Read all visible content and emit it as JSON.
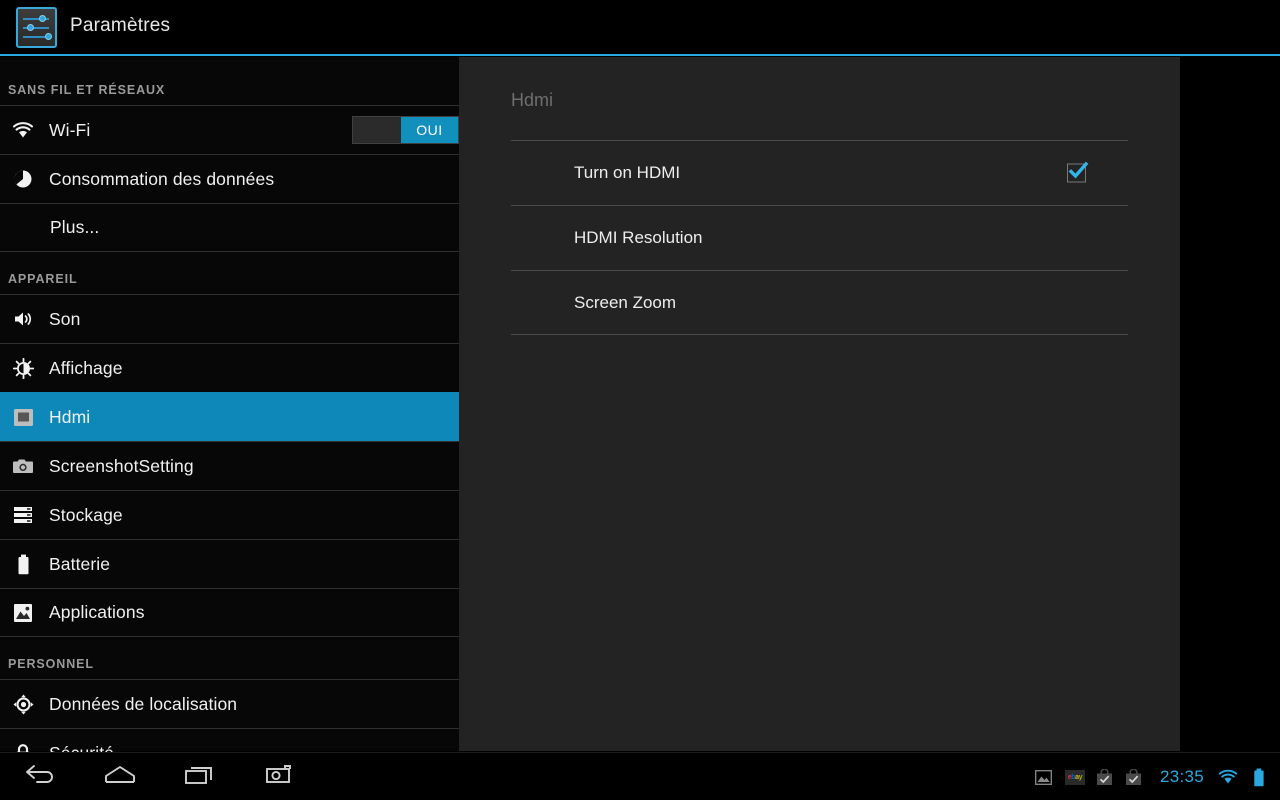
{
  "titlebar": {
    "title": "Paramètres",
    "icon": "settings-sliders-icon",
    "accent_color": "#2aa9e0"
  },
  "sidebar": {
    "sections": [
      {
        "header": "SANS FIL ET RÉSEAUX",
        "items": [
          {
            "label": "Wi-Fi",
            "icon": "wifi-icon",
            "toggle": {
              "state_label": "OUI",
              "on": true
            }
          },
          {
            "label": "Consommation des données",
            "icon": "data-usage-pie-icon"
          },
          {
            "label": "Plus...",
            "icon": "none",
            "indent": true
          }
        ]
      },
      {
        "header": "APPAREIL",
        "items": [
          {
            "label": "Son",
            "icon": "speaker-icon"
          },
          {
            "label": "Affichage",
            "icon": "brightness-icon"
          },
          {
            "label": "Hdmi",
            "icon": "hdmi-screen-icon",
            "selected": true
          },
          {
            "label": "ScreenshotSetting",
            "icon": "camera-icon"
          },
          {
            "label": "Stockage",
            "icon": "storage-bars-icon"
          },
          {
            "label": "Batterie",
            "icon": "battery-icon"
          },
          {
            "label": "Applications",
            "icon": "applications-picture-icon"
          }
        ]
      },
      {
        "header": "PERSONNEL",
        "items": [
          {
            "label": "Données de localisation",
            "icon": "location-crosshair-icon"
          },
          {
            "label": "Sécurité",
            "icon": "lock-icon"
          }
        ]
      }
    ],
    "selected_color": "#0d88b8"
  },
  "content": {
    "title": "Hdmi",
    "rows": [
      {
        "label": "Turn on HDMI",
        "control": "checkbox",
        "checked": true
      },
      {
        "label": "HDMI Resolution",
        "control": "none"
      },
      {
        "label": "Screen Zoom",
        "control": "none"
      }
    ],
    "check_color": "#33b5e5"
  },
  "systembar": {
    "nav": [
      {
        "name": "back",
        "icon": "back-arrow-icon"
      },
      {
        "name": "home",
        "icon": "home-icon"
      },
      {
        "name": "recents",
        "icon": "recents-icon"
      },
      {
        "name": "screenshot",
        "icon": "camera-icon"
      }
    ],
    "status": {
      "icons": [
        "image-icon",
        "ebay-icon",
        "shopping-bag-check-icon",
        "shopping-bag-check-icon"
      ],
      "ebay_letters": [
        "e",
        "b",
        "a",
        "y"
      ],
      "clock": "23:35",
      "wifi": "wifi-icon",
      "battery": "battery-full-icon",
      "accent_color": "#2aa9e0"
    }
  }
}
